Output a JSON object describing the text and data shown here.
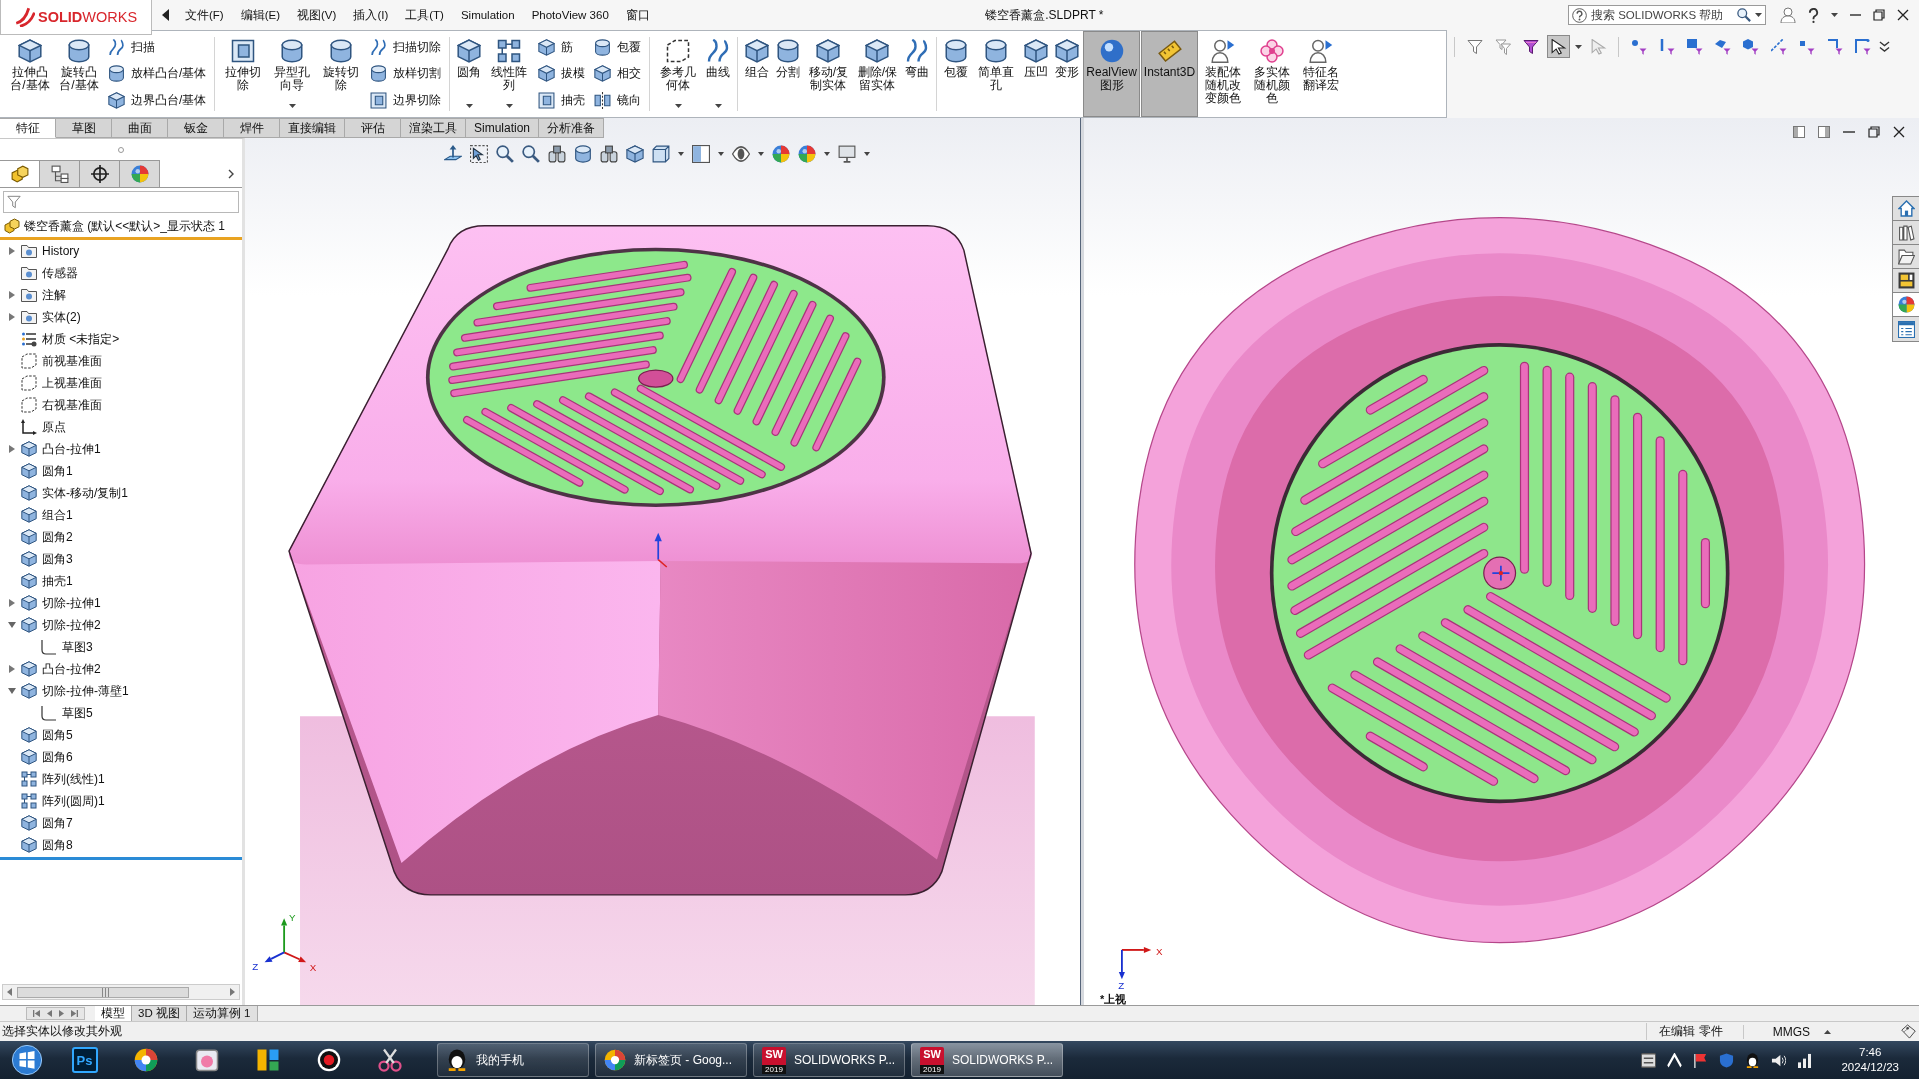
{
  "app": {
    "logo": "**SOLID**WORKS",
    "title": "镂空香薰盒.SLDPRT *"
  },
  "menu": [
    "文件(F)",
    "编辑(E)",
    "视图(V)",
    "插入(I)",
    "工具(T)",
    "Simulation",
    "PhotoView 360",
    "窗口"
  ],
  "search": {
    "placeholder": "搜索 SOLIDWORKS 帮助"
  },
  "ribbon": {
    "groups": [
      {
        "items": [
          {
            "kind": "large",
            "label": "拉伸凸台/基体",
            "on": false,
            "dropdown": false
          },
          {
            "kind": "large",
            "label": "旋转凸台/基体",
            "on": false,
            "dropdown": false
          },
          {
            "kind": "stack",
            "items": [
              "扫描",
              "放样凸台/基体",
              "边界凸台/基体"
            ]
          }
        ]
      },
      {
        "items": [
          {
            "kind": "large",
            "label": "拉伸切除",
            "on": false,
            "dropdown": false
          },
          {
            "kind": "large",
            "label": "异型孔向导",
            "on": false,
            "dropdown": true
          },
          {
            "kind": "large",
            "label": "旋转切除",
            "on": false,
            "dropdown": false
          },
          {
            "kind": "stack",
            "items": [
              "扫描切除",
              "放样切割",
              "边界切除"
            ]
          }
        ]
      },
      {
        "items": [
          {
            "kind": "large",
            "label": "圆角",
            "on": false,
            "dropdown": true
          },
          {
            "kind": "large",
            "label": "线性阵列",
            "on": false,
            "dropdown": true
          },
          {
            "kind": "stack",
            "items": [
              "筋",
              "拔模",
              "抽壳"
            ]
          },
          {
            "kind": "stack",
            "items": [
              "包覆",
              "相交",
              "镜向"
            ]
          }
        ]
      },
      {
        "items": [
          {
            "kind": "large",
            "label": "参考几何体",
            "on": false,
            "dropdown": true
          },
          {
            "kind": "large",
            "label": "曲线",
            "on": false,
            "dropdown": true
          }
        ]
      },
      {
        "items": [
          {
            "kind": "large",
            "label": "组合",
            "on": false,
            "dropdown": false
          },
          {
            "kind": "large",
            "label": "分割",
            "on": false,
            "dropdown": false
          },
          {
            "kind": "large",
            "label": "移动/复制实体",
            "on": false,
            "dropdown": false
          },
          {
            "kind": "large",
            "label": "删除/保留实体",
            "on": false,
            "dropdown": false
          },
          {
            "kind": "large",
            "label": "弯曲",
            "on": false,
            "dropdown": false
          }
        ]
      },
      {
        "items": [
          {
            "kind": "large",
            "label": "包覆",
            "on": false,
            "dropdown": false
          },
          {
            "kind": "large",
            "label": "简单直孔",
            "on": false,
            "dropdown": false
          },
          {
            "kind": "large",
            "label": "压凹",
            "on": false,
            "dropdown": false
          },
          {
            "kind": "large",
            "label": "变形",
            "on": false,
            "dropdown": false
          },
          {
            "kind": "large",
            "label": "RealView 图形",
            "on": true,
            "dropdown": false
          },
          {
            "kind": "large",
            "label": "Instant3D",
            "on": true,
            "dropdown": false
          },
          {
            "kind": "large",
            "label": "装配体随机改变颜色",
            "on": false,
            "dropdown": false
          },
          {
            "kind": "large",
            "label": "多实体随机颜色",
            "on": false,
            "dropdown": false
          },
          {
            "kind": "large",
            "label": "特征名翻译宏",
            "on": false,
            "dropdown": false
          }
        ]
      }
    ]
  },
  "selection_toolbar": [
    {
      "on": false
    },
    {
      "on": false
    },
    {
      "on": false
    },
    {
      "on": true
    },
    {
      "on": false
    },
    {
      "on": false
    },
    {
      "on": false
    },
    {
      "on": false
    },
    {
      "on": false
    },
    {
      "on": false
    },
    {
      "on": false
    },
    {
      "on": false
    },
    {
      "on": false
    },
    {
      "on": false
    }
  ],
  "command_tabs": [
    {
      "label": "特征",
      "selected": true
    },
    {
      "label": "草图",
      "selected": false
    },
    {
      "label": "曲面",
      "selected": false
    },
    {
      "label": "钣金",
      "selected": false
    },
    {
      "label": "焊件",
      "selected": false
    },
    {
      "label": "直接编辑",
      "selected": false
    },
    {
      "label": "评估",
      "selected": false
    },
    {
      "label": "渲染工具",
      "selected": false
    },
    {
      "label": "Simulation",
      "selected": false
    },
    {
      "label": "分析准备",
      "selected": false
    }
  ],
  "panel_tabs": [
    {
      "selected": true
    },
    {
      "selected": false
    },
    {
      "selected": false
    },
    {
      "selected": false
    }
  ],
  "tree": {
    "root": "镂空香薰盒 (默认<<默认>_显示状态 1",
    "items": [
      {
        "label": "History",
        "kind": "folder",
        "expanded": false
      },
      {
        "label": "传感器",
        "kind": "folder"
      },
      {
        "label": "注解",
        "kind": "folder",
        "expanded": false
      },
      {
        "label": "实体(2)",
        "kind": "folder",
        "expanded": false
      },
      {
        "label": "材质 <未指定>",
        "kind": "material"
      },
      {
        "label": "前视基准面",
        "kind": "plane"
      },
      {
        "label": "上视基准面",
        "kind": "plane"
      },
      {
        "label": "右视基准面",
        "kind": "plane"
      },
      {
        "label": "原点",
        "kind": "origin"
      },
      {
        "label": "凸台-拉伸1",
        "kind": "feature",
        "expanded": false
      },
      {
        "label": "圆角1",
        "kind": "feature"
      },
      {
        "label": "实体-移动/复制1",
        "kind": "feature"
      },
      {
        "label": "组合1",
        "kind": "feature"
      },
      {
        "label": "圆角2",
        "kind": "feature"
      },
      {
        "label": "圆角3",
        "kind": "feature"
      },
      {
        "label": "抽壳1",
        "kind": "feature"
      },
      {
        "label": "切除-拉伸1",
        "kind": "feature",
        "expanded": false
      },
      {
        "label": "切除-拉伸2",
        "kind": "feature",
        "expanded": true,
        "children": [
          {
            "label": "草图3",
            "kind": "sketch"
          }
        ]
      },
      {
        "label": "凸台-拉伸2",
        "kind": "feature",
        "expanded": false
      },
      {
        "label": "切除-拉伸-薄壁1",
        "kind": "feature",
        "expanded": true,
        "children": [
          {
            "label": "草图5",
            "kind": "sketch"
          }
        ]
      },
      {
        "label": "圆角5",
        "kind": "feature"
      },
      {
        "label": "圆角6",
        "kind": "feature"
      },
      {
        "label": "阵列(线性)1",
        "kind": "pattern"
      },
      {
        "label": "阵列(圆周)1",
        "kind": "pattern"
      },
      {
        "label": "圆角7",
        "kind": "feature"
      },
      {
        "label": "圆角8",
        "kind": "feature"
      }
    ]
  },
  "viewports": [
    {
      "kind": "isometric",
      "triad": {
        "x": "X",
        "y": "Y",
        "z": "Z"
      }
    },
    {
      "kind": "top",
      "label": "*上视",
      "triad": {
        "x": "X",
        "z": "Z"
      }
    }
  ],
  "task_pane_tabs": [
    {
      "selected": false
    },
    {
      "selected": false
    },
    {
      "selected": false
    },
    {
      "selected": false
    },
    {
      "selected": true
    },
    {
      "selected": false
    }
  ],
  "bottom_tabs": [
    {
      "label": "模型",
      "selected": true
    },
    {
      "label": "3D 视图",
      "selected": false
    },
    {
      "label": "运动算例 1",
      "selected": false
    }
  ],
  "status_bar": {
    "message": "选择实体以修改其外观",
    "mode": "在编辑 零件",
    "units": "MMGS"
  },
  "taskbar": {
    "pinned_label": "Ps",
    "windows": [
      {
        "kind": "qq",
        "title": "我的手机",
        "selected": false
      },
      {
        "kind": "browser",
        "title": "新标签页 - Goog...",
        "selected": false
      },
      {
        "kind": "solidworks",
        "title": "SOLIDWORKS P...",
        "icon_text": "SW",
        "badge": "2019",
        "selected": false
      },
      {
        "kind": "solidworks",
        "title": "SOLIDWORKS P...",
        "icon_text": "SW",
        "badge": "2019",
        "selected": true
      }
    ],
    "time": "7:46",
    "date": "2024/12/23"
  }
}
